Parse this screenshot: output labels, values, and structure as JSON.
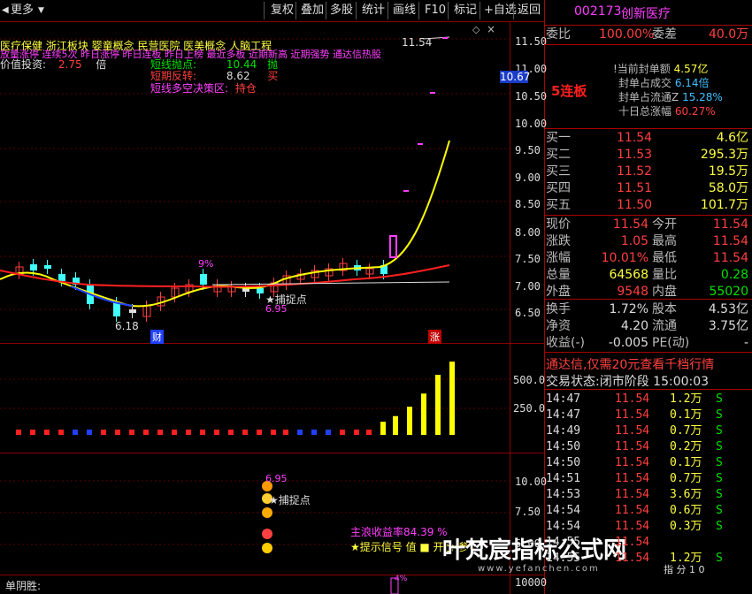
{
  "toolbar": {
    "left_arrow": "◀",
    "more": "更多",
    "buttons": [
      "复权",
      "叠加",
      "多股",
      "统计",
      "画线",
      "F10",
      "标记",
      "+自选",
      "返回"
    ]
  },
  "chart": {
    "concept_line1": "医疗保健 浙江板块 婴童概念 民营医院 医美概念 人脑工程",
    "concept_line2": "放量涨停 连续5次 昨日涨停 昨日连板 昨日上榜 最近多板 近期新高 近期强势 通达信热股",
    "value_label": "价值投资:",
    "value_num": "2.75",
    "value_unit": "倍",
    "short_sell_label": "短线抛点:",
    "short_sell_val": "10.44",
    "short_sell_tag": "抛",
    "short_rev_label": "短期反转:",
    "short_rev_val": "8.62",
    "short_rev_tag": "买",
    "short_zone_label": "短线多空决策区:",
    "short_zone_val": "持仓",
    "pct_9": "9%",
    "low_label": "6.18",
    "peak_label": "11.54",
    "catch_label": "★捕捉点",
    "catch_val": "6.95",
    "cai_label": "财",
    "zhang_label": "涨",
    "price_axis": [
      "11.50",
      "11.00",
      "10.50",
      "10.00",
      "9.50",
      "9.00",
      "8.50",
      "8.00",
      "7.50",
      "7.00",
      "6.50"
    ],
    "current_price_tag": "10.67",
    "vol_axis": [
      "500.0",
      "250.0"
    ],
    "ind_axis": [
      "10.00",
      "7.50",
      "5.00",
      "2.50"
    ],
    "ind_catch_val": "6.95",
    "ind_catch_label": "★捕捉点",
    "ind_main_label": "主浪收益率84.39 %",
    "ind_tip_label": "★提示信号 值 ■ 开仓 参",
    "bottom_label": "单阴胜:",
    "bottom_axis": "10000",
    "bottom_pct": "4%",
    "watermark": "叶梵宸指标公式网",
    "watermark_sub": "www.yefanchen.com"
  },
  "chart_data": {
    "type": "line",
    "price_ylim": [
      6.18,
      11.54
    ],
    "volume_series": {
      "name": "volume",
      "values": [
        30,
        30,
        30,
        30,
        30,
        30,
        30,
        30,
        30,
        30,
        30,
        30,
        30,
        30,
        30,
        30,
        30,
        30,
        30,
        30,
        30,
        30,
        30,
        30,
        30,
        30,
        35,
        50,
        75,
        110,
        160,
        195
      ]
    },
    "volume_colors": [
      "red",
      "red",
      "red",
      "red",
      "blue",
      "blue",
      "red",
      "red",
      "red",
      "red",
      "red",
      "red",
      "red",
      "red",
      "red",
      "red",
      "red",
      "red",
      "red",
      "red",
      "blue",
      "blue",
      "blue",
      "red",
      "red",
      "red",
      "yellow",
      "yellow",
      "yellow",
      "yellow",
      "yellow",
      "yellow"
    ]
  },
  "panel": {
    "code": "002173",
    "name": "创新医疗",
    "wei_bi_label": "委比",
    "wei_bi_val": "100.00%",
    "wei_cha_label": "委差",
    "wei_cha_val": "40.0万",
    "lianban": "5连板",
    "feng_dan": "!当前封单额",
    "feng_dan_val": "4.57亿",
    "feng_cheng": "封单占成交",
    "feng_cheng_val": "6.14倍",
    "feng_liu": "封单占流通Z",
    "feng_liu_val": "15.28%",
    "shi_ri": "十日总涨幅",
    "shi_ri_val": "60.27%",
    "bids": [
      {
        "label": "买一",
        "price": "11.54",
        "vol": "4.6亿"
      },
      {
        "label": "买二",
        "price": "11.53",
        "vol": "295.3万"
      },
      {
        "label": "买三",
        "price": "11.52",
        "vol": "19.5万"
      },
      {
        "label": "买四",
        "price": "11.51",
        "vol": "58.0万"
      },
      {
        "label": "买五",
        "price": "11.50",
        "vol": "101.7万"
      }
    ],
    "stats": [
      {
        "l1": "现价",
        "v1": "11.54",
        "l2": "今开",
        "v2": "11.54"
      },
      {
        "l1": "涨跌",
        "v1": "1.05",
        "l2": "最高",
        "v2": "11.54"
      },
      {
        "l1": "涨幅",
        "v1": "10.01%",
        "l2": "最低",
        "v2": "11.54"
      },
      {
        "l1": "总量",
        "v1": "64568",
        "l2": "量比",
        "v2": "0.28"
      },
      {
        "l1": "外盘",
        "v1": "9548",
        "l2": "内盘",
        "v2": "55020"
      }
    ],
    "stats2": [
      {
        "l1": "换手",
        "v1": "1.72%",
        "l2": "股本",
        "v2": "4.53亿"
      },
      {
        "l1": "净资",
        "v1": "4.20",
        "l2": "流通",
        "v2": "3.75亿"
      },
      {
        "l1": "收益(-)",
        "v1": "-0.005",
        "l2": "PE(动)",
        "v2": "-"
      }
    ],
    "ad": "通达信,仅需20元查看千档行情",
    "status_label": "交易状态:",
    "status_val": "闭市阶段 15:00:03",
    "ticks": [
      {
        "t": "14:47",
        "p": "11.54",
        "v": "1.2万",
        "s": "S"
      },
      {
        "t": "14:47",
        "p": "11.54",
        "v": "0.1万",
        "s": "S"
      },
      {
        "t": "14:49",
        "p": "11.54",
        "v": "0.7万",
        "s": "S"
      },
      {
        "t": "14:50",
        "p": "11.54",
        "v": "0.2万",
        "s": "S"
      },
      {
        "t": "14:50",
        "p": "11.54",
        "v": "0.1万",
        "s": "S"
      },
      {
        "t": "14:51",
        "p": "11.54",
        "v": "0.7万",
        "s": "S"
      },
      {
        "t": "14:53",
        "p": "11.54",
        "v": "3.6万",
        "s": "S"
      },
      {
        "t": "14:54",
        "p": "11.54",
        "v": "0.6万",
        "s": "S"
      },
      {
        "t": "14:54",
        "p": "11.54",
        "v": "0.3万",
        "s": "S"
      },
      {
        "t": "14:55",
        "p": "11.54",
        "v": "",
        "s": ""
      },
      {
        "t": "14:55",
        "p": "11.54",
        "v": "1.2万",
        "s": "S"
      }
    ],
    "tick_footer": "指 分 1 0"
  }
}
